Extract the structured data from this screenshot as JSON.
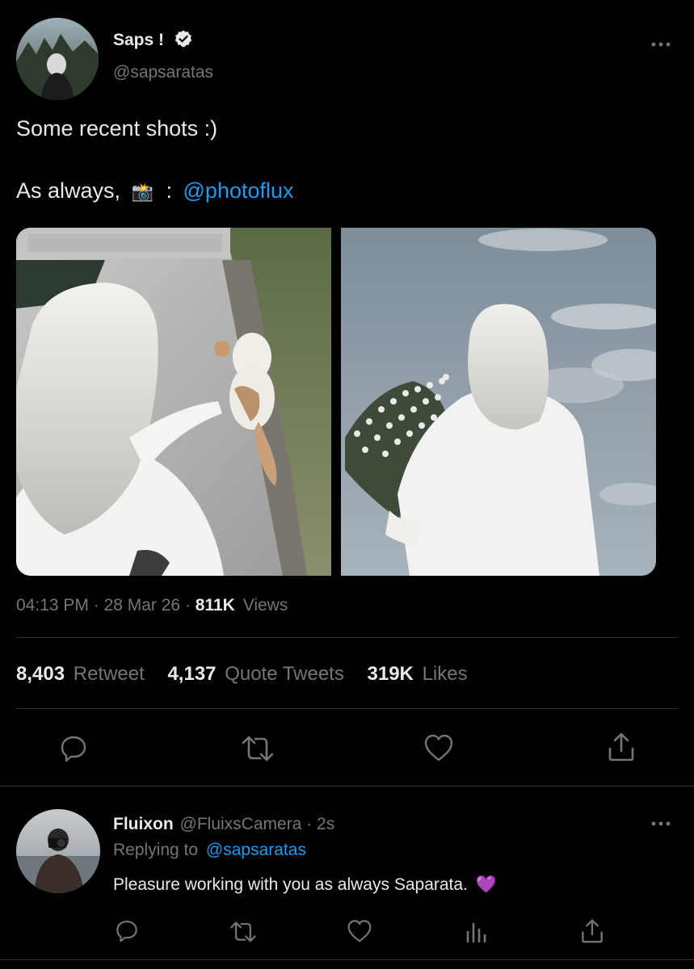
{
  "tweet": {
    "author_name": "Saps !",
    "author_handle": "@sapsaratas",
    "text_line1": "Some recent shots :)",
    "text_line2_prefix": "As always,",
    "text_line2_emoji": "📸",
    "text_line2_colon": ":",
    "mention": "@photoflux",
    "time": "04:13 PM",
    "date": "28 Mar 26",
    "views_count": "811K",
    "views_label": "Views",
    "stats": {
      "retweets_count": "8,403",
      "retweets_label": "Retweet",
      "quotes_count": "4,137",
      "quotes_label": "Quote Tweets",
      "likes_count": "319K",
      "likes_label": "Likes"
    }
  },
  "reply": {
    "author_name": "Fluixon",
    "author_handle": "@FluixsCamera",
    "time": "2s",
    "replying_to_label": "Replying to",
    "replying_to_handle": "@sapsaratas",
    "text": "Pleasure working with you as always Saparata.",
    "emoji": "💜"
  },
  "icons": {
    "verified": "verified-badge-icon",
    "more": "more-icon",
    "reply": "reply-icon",
    "retweet": "retweet-icon",
    "like": "heart-icon",
    "analytics": "analytics-icon",
    "share": "share-icon"
  },
  "colors": {
    "background": "#000000",
    "text": "#e7e9ea",
    "muted": "#71767b",
    "link": "#1d9bf0",
    "divider": "#2f3336",
    "heart_emoji": "#a855f7"
  }
}
